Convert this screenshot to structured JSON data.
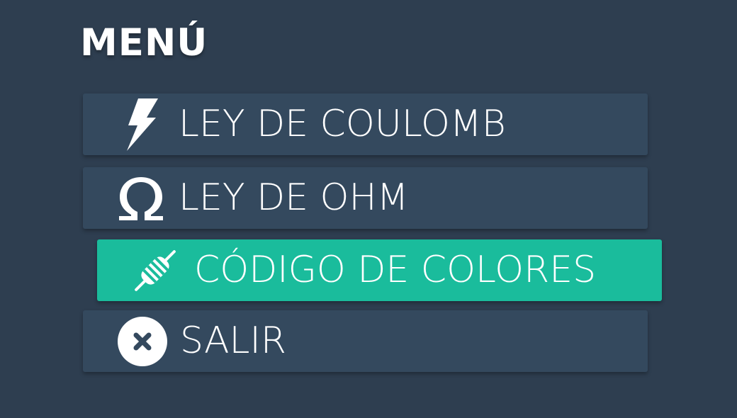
{
  "menu": {
    "title": "MENÚ",
    "items": [
      {
        "label": "LEY DE COULOMB",
        "icon": "lightning-bolt-icon",
        "active": false
      },
      {
        "label": "LEY DE OHM",
        "icon": "omega-icon",
        "active": false
      },
      {
        "label": "CÓDIGO DE COLORES",
        "icon": "resistor-icon",
        "active": true
      },
      {
        "label": "SALIR",
        "icon": "close-circle-icon",
        "active": false
      }
    ]
  },
  "colors": {
    "background": "#2e3e50",
    "item": "#34495e",
    "active": "#1abc9c",
    "text": "#ffffff"
  }
}
